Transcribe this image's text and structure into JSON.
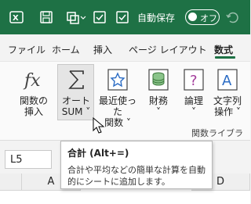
{
  "titlebar": {
    "autosave_label": "自動保存",
    "autosave_state": "オフ",
    "brand_color": "#1e7145"
  },
  "tabs": [
    "ファイル",
    "ホーム",
    "挿入",
    "ページ レイアウト",
    "数式"
  ],
  "active_tab": "数式",
  "ribbon": {
    "commands": [
      {
        "line1": "関数の",
        "line2": "挿入",
        "icon": "function-fx-icon"
      },
      {
        "line1": "オート",
        "line2": "SUM ˅",
        "icon": "sigma-icon"
      },
      {
        "line1": "最近使った",
        "line2": "関数 ˅",
        "icon": "star-icon"
      },
      {
        "line1": "財務",
        "line2": "˅",
        "icon": "coins-icon"
      },
      {
        "line1": "論理",
        "line2": "˅",
        "icon": "question-book-icon"
      },
      {
        "line1": "文字列",
        "line2": "操作 ˅",
        "icon": "text-book-icon"
      }
    ],
    "group_label": "関数ライブラリ"
  },
  "namebox": {
    "value": "L5"
  },
  "columns": [
    "A",
    "D"
  ],
  "tooltip": {
    "title": "合計 (Alt+=)",
    "description": "合計や平均などの簡単な計算を自動的にシートに追加します。"
  }
}
